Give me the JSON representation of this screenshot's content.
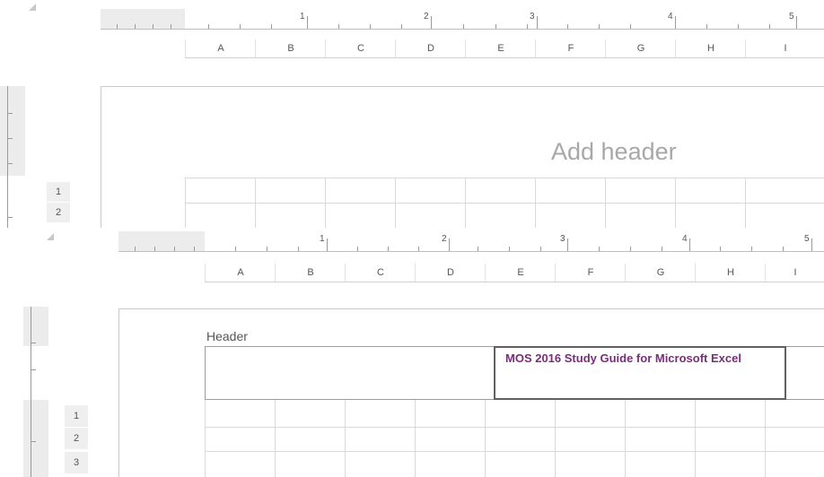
{
  "columns": [
    "A",
    "B",
    "C",
    "D",
    "E",
    "F",
    "G",
    "H",
    "I"
  ],
  "ruler_numbers": [
    "1",
    "2",
    "3",
    "4",
    "5"
  ],
  "top_view": {
    "header_placeholder": "Add header",
    "row_numbers": [
      "1",
      "2"
    ]
  },
  "bottom_view": {
    "header_label": "Header",
    "header_text": "MOS 2016 Study Guide for Microsoft Excel",
    "header_text_color": "#7b2c7c",
    "row_numbers": [
      "1",
      "2",
      "3"
    ]
  }
}
